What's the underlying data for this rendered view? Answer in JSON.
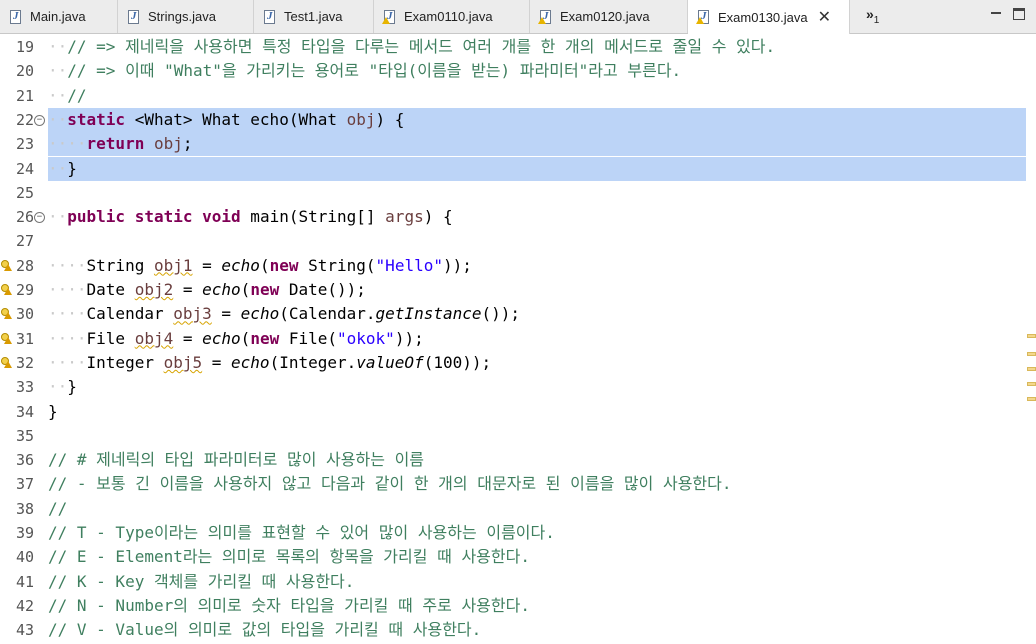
{
  "tabs": [
    {
      "label": "Main.java",
      "warn": false
    },
    {
      "label": "Strings.java",
      "warn": false
    },
    {
      "label": "Test1.java",
      "warn": false
    },
    {
      "label": "Exam0110.java",
      "warn": true
    },
    {
      "label": "Exam0120.java",
      "warn": true
    },
    {
      "label": "Exam0130.java",
      "warn": true,
      "active": true
    }
  ],
  "overflow": {
    "symbol": "»",
    "count": "1"
  },
  "lines": [
    {
      "n": "19",
      "html": "<span class='dot'>··</span><span class='cmt'>// => 제네릭을 사용하면 특정 타입을 다루는 메서드 여러 개를 한 개의 메서드로 줄일 수 있다.</span>"
    },
    {
      "n": "20",
      "html": "<span class='dot'>··</span><span class='cmt'>// => 이때 \"What\"을 가리키는 용어로 \"타입(이름을 받는) 파라미터\"라고 부른다.</span>"
    },
    {
      "n": "21",
      "html": "<span class='dot'>··</span><span class='cmt'>//</span>"
    },
    {
      "n": "22",
      "fold": true,
      "sel": true,
      "html": "<span class='dot'>··</span><span class='kw'>static</span> &lt;What&gt; What echo(What <span class='var'>obj</span>) {"
    },
    {
      "n": "23",
      "sel": true,
      "html": "<span class='dot'>····</span><span class='kw'>return</span> <span class='var'>obj</span>;"
    },
    {
      "n": "24",
      "sel": true,
      "html": "<span class='dot'>··</span>}"
    },
    {
      "n": "25",
      "html": ""
    },
    {
      "n": "26",
      "fold": true,
      "html": "<span class='dot'>··</span><span class='kw'>public</span> <span class='kw'>static</span> <span class='kw'>void</span> main(String[] <span class='var'>args</span>) {"
    },
    {
      "n": "27",
      "html": ""
    },
    {
      "n": "28",
      "warn": true,
      "html": "<span class='dot'>····</span>String <span class='var warnline'>obj1</span> = <span class='ital'>echo</span>(<span class='kw'>new</span> String(<span class='str'>\"Hello\"</span>));"
    },
    {
      "n": "29",
      "warn": true,
      "html": "<span class='dot'>····</span>Date <span class='var warnline'>obj2</span> = <span class='ital'>echo</span>(<span class='kw'>new</span> Date());"
    },
    {
      "n": "30",
      "warn": true,
      "html": "<span class='dot'>····</span>Calendar <span class='var warnline'>obj3</span> = <span class='ital'>echo</span>(Calendar.<span class='ital'>getInstance</span>());"
    },
    {
      "n": "31",
      "warn": true,
      "html": "<span class='dot'>····</span>File <span class='var warnline'>obj4</span> = <span class='ital'>echo</span>(<span class='kw'>new</span> File(<span class='str'>\"okok\"</span>));"
    },
    {
      "n": "32",
      "warn": true,
      "html": "<span class='dot'>····</span>Integer <span class='var warnline'>obj5</span> = <span class='ital'>echo</span>(Integer.<span class='ital'>valueOf</span>(100));"
    },
    {
      "n": "33",
      "html": "<span class='dot'>··</span>}"
    },
    {
      "n": "34",
      "html": "}"
    },
    {
      "n": "35",
      "html": ""
    },
    {
      "n": "36",
      "html": "<span class='cmt'>// # 제네릭의 타입 파라미터로 많이 사용하는 이름</span>"
    },
    {
      "n": "37",
      "html": "<span class='cmt'>// - 보통 긴 이름을 사용하지 않고 다음과 같이 한 개의 대문자로 된 이름을 많이 사용한다.</span>"
    },
    {
      "n": "38",
      "html": "<span class='cmt'>//</span>"
    },
    {
      "n": "39",
      "html": "<span class='cmt'>// T - Type이라는 의미를 표현할 수 있어 많이 사용하는 이름이다.</span>"
    },
    {
      "n": "40",
      "html": "<span class='cmt'>// E - Element라는 의미로 목록의 항목을 가리킬 때 사용한다.</span>"
    },
    {
      "n": "41",
      "html": "<span class='cmt'>// K - Key 객체를 가리킬 때 사용한다.</span>"
    },
    {
      "n": "42",
      "html": "<span class='cmt'>// N - Number의 의미로 숫자 타입을 가리킬 때 주로 사용한다.</span>"
    },
    {
      "n": "43",
      "html": "<span class='cmt'>// V - Value의 의미로 값의 타입을 가리킬 때 사용한다.</span>"
    }
  ]
}
